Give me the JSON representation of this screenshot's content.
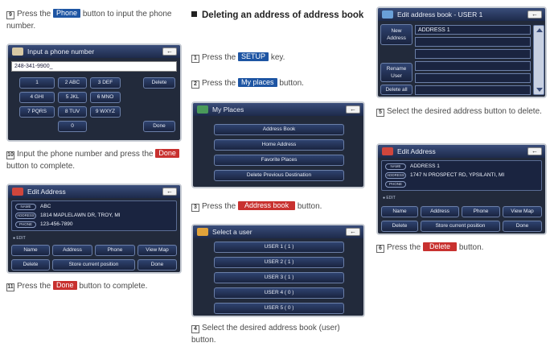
{
  "col1": {
    "step9": {
      "num": "9",
      "pre": "Press the",
      "chip": "Phone",
      "post": "button to input the phone number."
    },
    "phone_screen": {
      "title": "Input a phone number",
      "back": "←",
      "value": "248-341-9900_",
      "keys": [
        "1",
        "2 ABC",
        "3 DEF",
        "4 GHI",
        "5 JKL",
        "6 MNO",
        "7 PQRS",
        "8 TUV",
        "9 WXYZ",
        "0"
      ],
      "delete": "Delete",
      "done": "Done"
    },
    "step10": {
      "num": "10",
      "pre": "Input the phone number and press the",
      "chip": "Done",
      "post": "button to complete."
    },
    "edit_screen": {
      "title": "Edit Address",
      "back": "←",
      "name_tag": "NAME",
      "name_val": "ABC",
      "address_tag": "ADDRESS",
      "address_val": "1814 MAPLELAWN DR, TROY, MI",
      "phone_tag": "PHONE",
      "phone_val": "123-456-7890",
      "edit_label": "● EDIT",
      "row1": [
        "Name",
        "Address",
        "Phone",
        "View Map"
      ],
      "row2": [
        "Delete",
        "Store current position",
        "Done"
      ]
    },
    "step11": {
      "num": "11",
      "pre": "Press the",
      "chip": "Done",
      "post": "button to complete."
    }
  },
  "col2": {
    "heading": "Deleting an address of address book",
    "step1": {
      "num": "1",
      "pre": "Press the",
      "chip": "SETUP",
      "post": "key."
    },
    "step2": {
      "num": "2",
      "pre": "Press the",
      "chip": "My places",
      "post": "button."
    },
    "places_screen": {
      "title": "My Places",
      "back": "←",
      "items": [
        "Address Book",
        "Home Address",
        "Favorite Places",
        "Delete Previous Destination"
      ]
    },
    "step3": {
      "num": "3",
      "pre": "Press the",
      "chip": "Address book",
      "post": "button."
    },
    "user_screen": {
      "title": "Select a user",
      "back": "←",
      "items": [
        "USER 1 ( 1 )",
        "USER 2 ( 1 )",
        "USER 3 ( 1 )",
        "USER 4 ( 0 )",
        "USER 5 ( 0 )"
      ]
    },
    "step4": {
      "num": "4",
      "pre": "Select the desired address book (user) button.",
      "chip": "",
      "post": ""
    }
  },
  "col3": {
    "book_screen": {
      "title": "Edit address book - USER 1",
      "back": "←",
      "new_address": "New Address",
      "rename_user": "Rename User",
      "delete_all": "Delete all",
      "list": [
        "ADDRESS 1",
        "",
        "",
        "",
        "",
        ""
      ]
    },
    "step5": {
      "num": "5",
      "pre": "Select the desired address button to delete.",
      "chip": "",
      "post": ""
    },
    "edit_screen": {
      "title": "Edit Address",
      "back": "←",
      "name_tag": "NAME",
      "name_val": "ADDRESS 1",
      "address_tag": "ADDRESS",
      "address_val": "1747 N PROSPECT RD, YPSILANTI, MI",
      "phone_tag": "PHONE",
      "edit_label": "● EDIT",
      "row1": [
        "Name",
        "Address",
        "Phone",
        "View Map"
      ],
      "row2": [
        "Delete",
        "Store current position",
        "Done"
      ]
    },
    "step6": {
      "num": "6",
      "pre": "Press the",
      "chip": "Delete",
      "post": "button."
    }
  }
}
